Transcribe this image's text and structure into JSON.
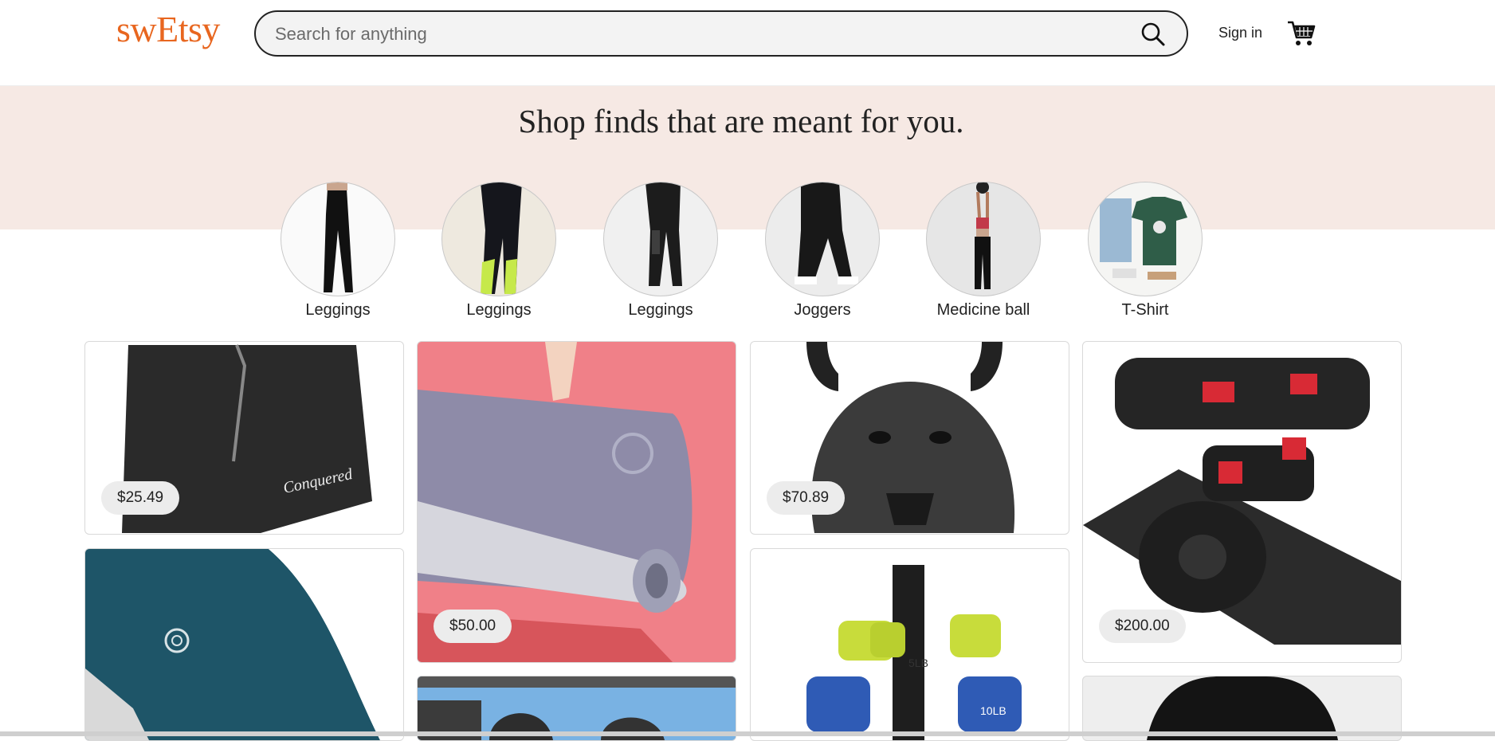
{
  "header": {
    "logo": "swEtsy",
    "search_placeholder": "Search for anything",
    "search_value": "",
    "signin_label": "Sign in",
    "brand_color": "#e8661f"
  },
  "banner": {
    "headline": "Shop finds that are meant for you.",
    "background": "#f6e9e4"
  },
  "categories": [
    {
      "label": "Leggings",
      "icon": "flared-leggings-photo"
    },
    {
      "label": "Leggings",
      "icon": "color-block-leggings-photo"
    },
    {
      "label": "Leggings",
      "icon": "mesh-leggings-photo"
    },
    {
      "label": "Joggers",
      "icon": "joggers-photo"
    },
    {
      "label": "Medicine ball",
      "icon": "medicine-ball-photo"
    },
    {
      "label": "T-Shirt",
      "icon": "tshirt-photo"
    }
  ],
  "products": [
    {
      "name": "black-shorts",
      "price": "$25.49"
    },
    {
      "name": "pink-yoga-mat",
      "price": "$50.00"
    },
    {
      "name": "gorilla-kettlebell",
      "price": "$70.89"
    },
    {
      "name": "adjustable-dumbbells",
      "price": "$200.00"
    },
    {
      "name": "blue-yoga-mat",
      "price": ""
    },
    {
      "name": "kettlebell-gym-photo",
      "price": ""
    },
    {
      "name": "dumbbell-rack-set",
      "price": ""
    },
    {
      "name": "black-hoodie",
      "price": ""
    }
  ]
}
